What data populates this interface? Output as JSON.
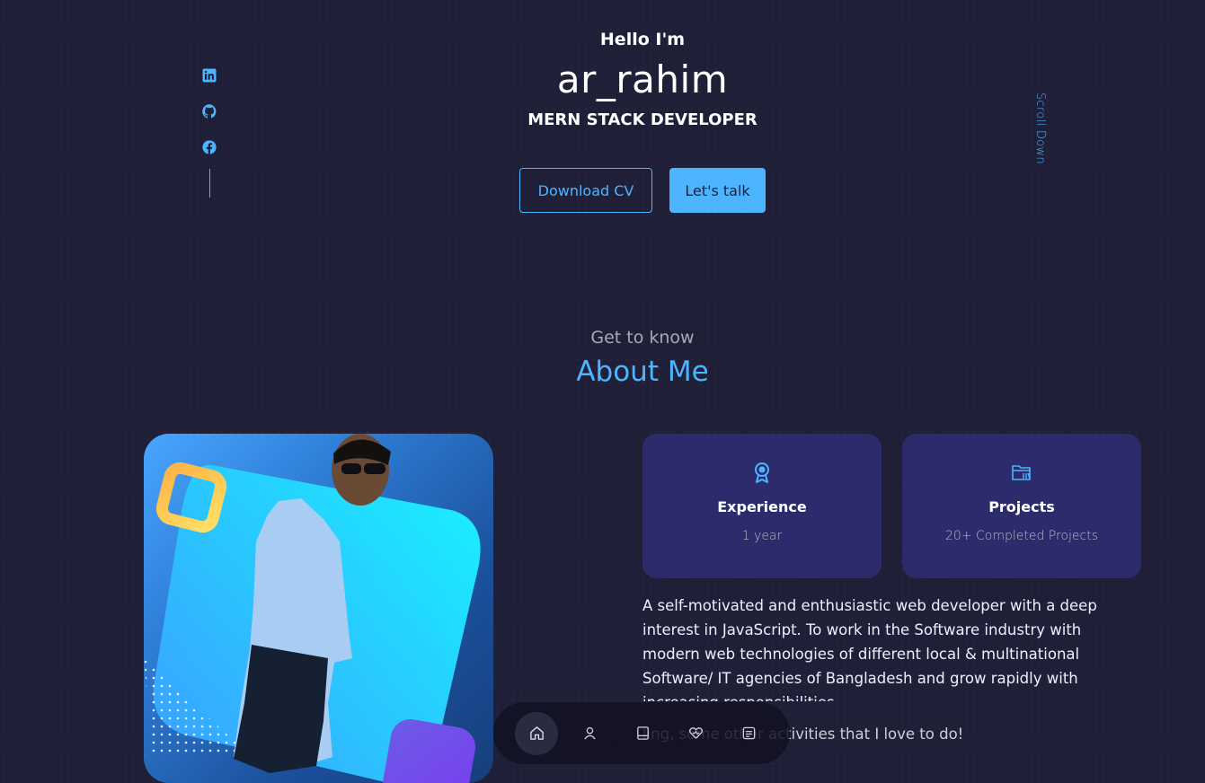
{
  "social": [
    {
      "name": "linkedin-icon"
    },
    {
      "name": "github-icon"
    },
    {
      "name": "facebook-icon"
    }
  ],
  "header": {
    "greeting": "Hello I'm",
    "name": "ar_rahim",
    "role": "MERN STACK DEVELOPER",
    "download_cv": "Download CV",
    "lets_talk": "Let's talk",
    "scroll_down": "Scroll Down"
  },
  "about": {
    "subtitle": "Get to know",
    "title": "About Me",
    "cards": [
      {
        "icon": "award-icon",
        "title": "Experience",
        "value": "1 year"
      },
      {
        "icon": "folder-icon",
        "title": "Projects",
        "value": "20+ Completed Projects"
      }
    ],
    "description": "A self-motivated and enthusiastic web developer with a deep interest in JavaScript. To work in the Software industry with modern web technologies of different local & multinational Software/ IT agencies of Bangladesh and grow rapidly with increasing responsibilities",
    "description2_visible": "ling, some other activities that I love to do!"
  },
  "nav": [
    {
      "icon": "home-icon",
      "active": true
    },
    {
      "icon": "user-icon",
      "active": false
    },
    {
      "icon": "book-icon",
      "active": false
    },
    {
      "icon": "heart-icon",
      "active": false
    },
    {
      "icon": "message-icon",
      "active": false
    }
  ],
  "colors": {
    "background": "#1f1f38",
    "accent": "#4db5ff",
    "card": "#2c2c6c"
  }
}
